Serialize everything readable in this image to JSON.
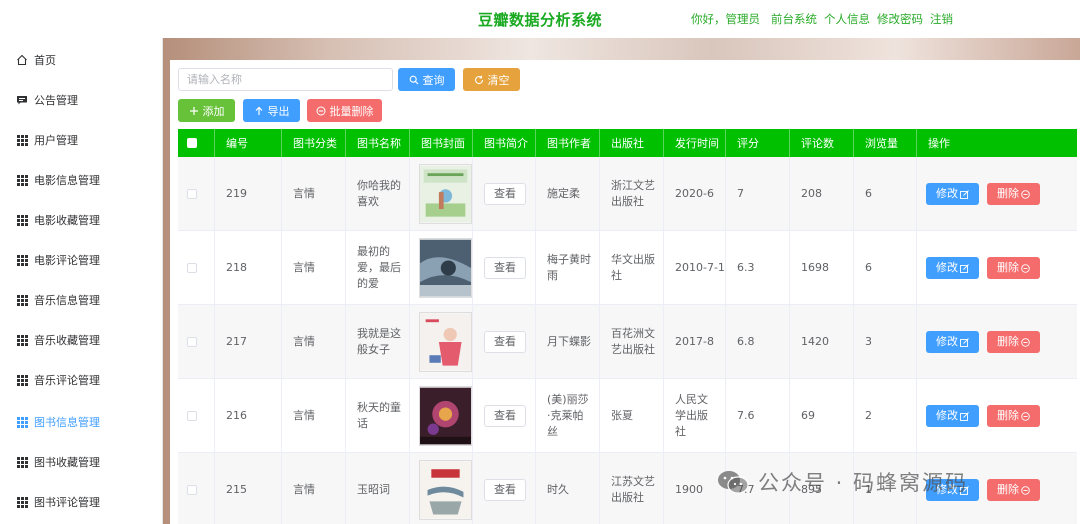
{
  "header": {
    "title": "豆瓣数据分析系统",
    "greeting": "你好，管理员",
    "nav": [
      "前台系统",
      "个人信息",
      "修改密码",
      "注销"
    ]
  },
  "sidebar": {
    "items": [
      {
        "label": "首页",
        "icon": "home-icon"
      },
      {
        "label": "公告管理",
        "icon": "message-icon"
      },
      {
        "label": "用户管理",
        "icon": "grid-icon"
      },
      {
        "label": "电影信息管理",
        "icon": "grid-icon"
      },
      {
        "label": "电影收藏管理",
        "icon": "grid-icon"
      },
      {
        "label": "电影评论管理",
        "icon": "grid-icon"
      },
      {
        "label": "音乐信息管理",
        "icon": "grid-icon"
      },
      {
        "label": "音乐收藏管理",
        "icon": "grid-icon"
      },
      {
        "label": "音乐评论管理",
        "icon": "grid-icon"
      },
      {
        "label": "图书信息管理",
        "icon": "grid-icon",
        "active": true
      },
      {
        "label": "图书收藏管理",
        "icon": "grid-icon"
      },
      {
        "label": "图书评论管理",
        "icon": "grid-icon"
      }
    ]
  },
  "toolbar": {
    "search_placeholder": "请输入名称",
    "search_value": "",
    "query_label": "查询",
    "clear_label": "清空",
    "add_label": "添加",
    "export_label": "导出",
    "batch_delete_label": "批量删除"
  },
  "table": {
    "columns": [
      "编号",
      "图书分类",
      "图书名称",
      "图书封面",
      "图书简介",
      "图书作者",
      "出版社",
      "发行时间",
      "评分",
      "评论数",
      "浏览量",
      "操作"
    ],
    "view_label": "查看",
    "edit_label": "修改",
    "delete_label": "删除",
    "rows": [
      {
        "id": "219",
        "category": "言情",
        "name": "你哈我的喜欢",
        "author": "施定柔",
        "publisher": "浙江文艺出版社",
        "date": "2020-6",
        "rating": "7",
        "comments": "208",
        "views": "6"
      },
      {
        "id": "218",
        "category": "言情",
        "name": "最初的爱，最后的爱",
        "author": "梅子黄时雨",
        "publisher": "华文出版社",
        "date": "2010-7-1",
        "rating": "6.3",
        "comments": "1698",
        "views": "6"
      },
      {
        "id": "217",
        "category": "言情",
        "name": "我就是这般女子",
        "author": "月下蝶影",
        "publisher": "百花洲文艺出版社",
        "date": "2017-8",
        "rating": "6.8",
        "comments": "1420",
        "views": "3"
      },
      {
        "id": "216",
        "category": "言情",
        "name": "秋天的童话",
        "author": "(美)丽莎·克莱帕丝",
        "publisher": "张夏",
        "date": "人民文学出版社",
        "rating": "7.6",
        "comments": "69",
        "views": "2"
      },
      {
        "id": "215",
        "category": "言情",
        "name": "玉昭词",
        "author": "时久",
        "publisher": "江苏文艺出版社",
        "date": "1900",
        "rating": "7.7",
        "comments": "895",
        "views": "1"
      }
    ]
  },
  "watermark": {
    "text": "公众号 · 码蜂窝源码"
  },
  "colors": {
    "brand_green": "#1aaa22",
    "table_header": "#00c000",
    "primary": "#409eff",
    "warning": "#e6a23c",
    "success": "#67c23a",
    "danger": "#f56c6c"
  }
}
